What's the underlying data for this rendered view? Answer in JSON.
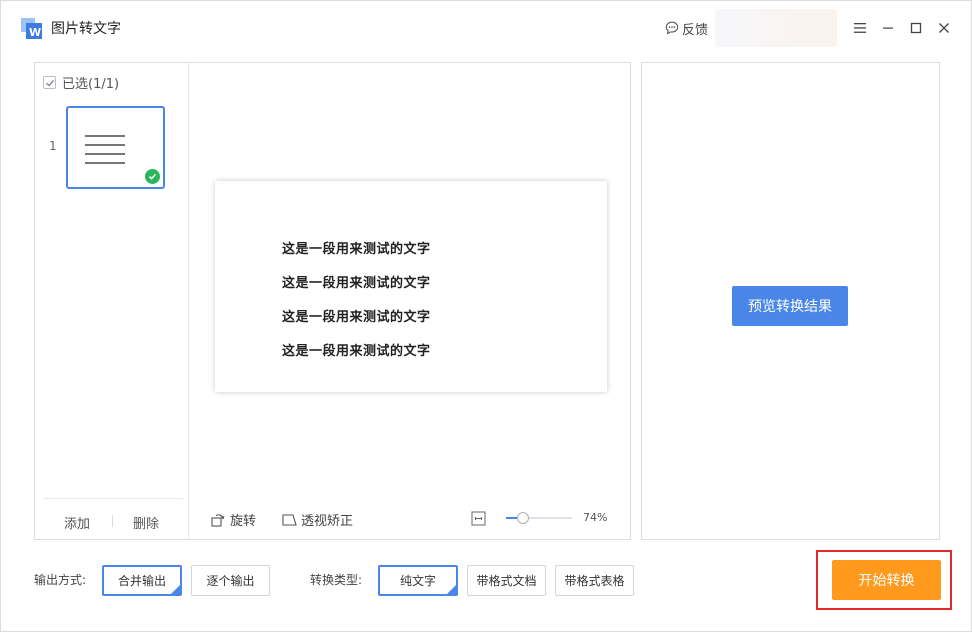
{
  "app": {
    "title": "图片转文字"
  },
  "header": {
    "feedback_label": "反馈"
  },
  "file_list": {
    "select_all_label": "已选(1/1)",
    "items": [
      {
        "index": "1",
        "selected": true
      }
    ],
    "add_label": "添加",
    "delete_label": "删除"
  },
  "preview": {
    "page_lines": [
      "这是一段用来测试的文字",
      "这是一段用来测试的文字",
      "这是一段用来测试的文字",
      "这是一段用来测试的文字"
    ],
    "rotate_label": "旋转",
    "perspective_label": "透视矫正",
    "zoom_label": "74%",
    "zoom_level": 0.2
  },
  "result": {
    "preview_button_label": "预览转换结果"
  },
  "options": {
    "output_mode_label": "输出方式:",
    "output_modes": [
      "合并输出",
      "逐个输出"
    ],
    "output_mode_selected": "合并输出",
    "convert_type_label": "转换类型:",
    "convert_types": [
      "纯文字",
      "带格式文档",
      "带格式表格"
    ],
    "convert_type_selected": "纯文字"
  },
  "start_button_label": "开始转换",
  "colors": {
    "accent": "#4a86e8",
    "start": "#ff9a1f",
    "highlight_frame": "#e22b2b",
    "success": "#2db55d"
  }
}
